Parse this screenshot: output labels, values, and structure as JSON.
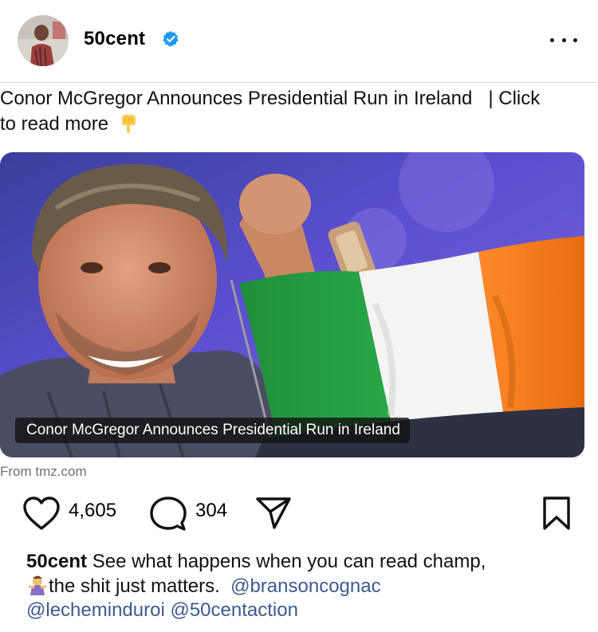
{
  "header": {
    "username": "50cent",
    "verified_icon": "verified-badge-icon",
    "avatar_icon": "profile-avatar",
    "more_icon": "more-options-icon"
  },
  "post": {
    "text_main": "Conor McGregor Announces Presidential Run in Ireland",
    "text_separator": "| Click",
    "text_continued": "to read more",
    "text_emoji_icon": "pointing-down-emoji",
    "media": {
      "caption": "Conor McGregor Announces Presidential Run in Ireland",
      "source": "From tmz.com",
      "flag_colors": [
        "#169b62",
        "#ffffff",
        "#ff883e"
      ]
    }
  },
  "actions": {
    "like_icon": "heart-icon",
    "like_count": "4,605",
    "comment_icon": "comment-bubble-icon",
    "comment_count": "304",
    "share_icon": "send-paper-plane-icon",
    "save_icon": "bookmark-icon"
  },
  "caption": {
    "username": "50cent",
    "line1": "See what happens when you can read champ,",
    "emoji_icon": "genie-emoji",
    "line2": "the shit just matters.",
    "mentions": [
      "@bransoncognac",
      "@lecheminduroi",
      "@50centaction"
    ]
  },
  "colors": {
    "accent_verified": "#1d9bf0",
    "mention": "#3e5a8e",
    "divider": "#dcdcdc"
  }
}
